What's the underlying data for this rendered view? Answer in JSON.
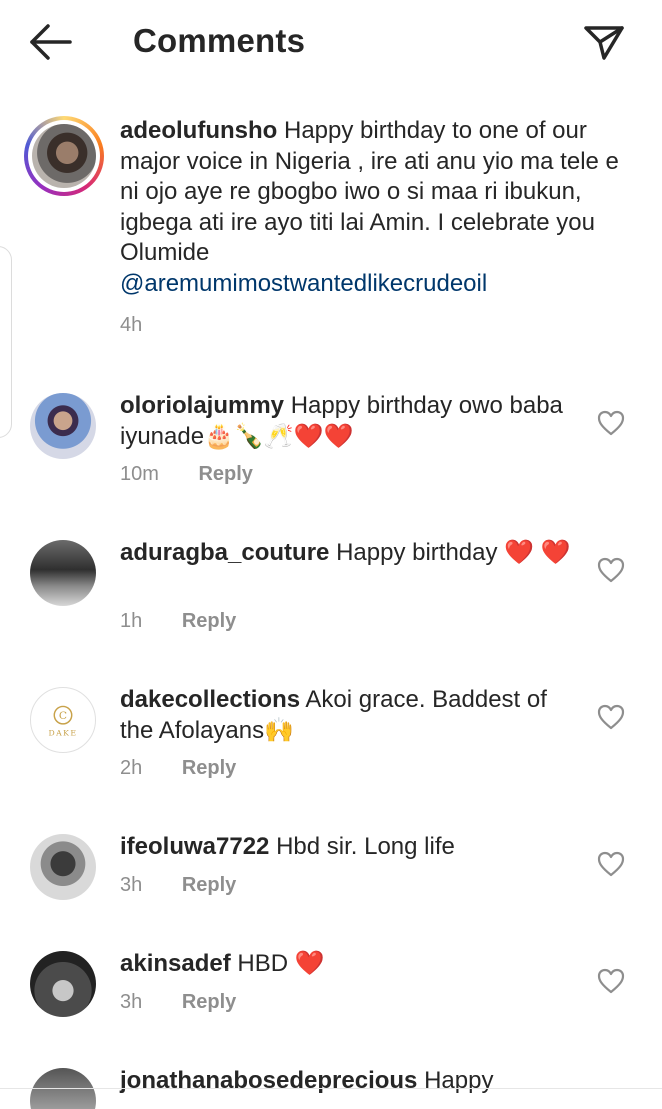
{
  "header": {
    "title": "Comments",
    "back_icon": "arrow-left-icon",
    "share_icon": "paper-plane-icon"
  },
  "caption": {
    "username": "adeolufunsho",
    "text": "Happy birthday to one of our major voice in Nigeria , ire ati anu yio ma tele e ni ojo aye re gbogbo iwo o si maa ri ibukun, igbega ati ire ayo titi lai Amin. I celebrate you Olumide",
    "mention": "@aremumimostwantedlikecrudeoil",
    "time": "4h"
  },
  "comments": [
    {
      "username": "oloriolajummy",
      "text": "Happy birthday owo baba iyunade🎂🍾🥂❤️❤️",
      "time": "10m",
      "reply_label": "Reply"
    },
    {
      "username": "aduragba_couture",
      "text": "Happy birthday ❤️ ❤️",
      "time": "1h",
      "reply_label": "Reply"
    },
    {
      "username": "dakecollections",
      "text": "Akoi grace. Baddest of the Afolayans🙌",
      "time": "2h",
      "reply_label": "Reply",
      "avatar_logo_text": "DAKE"
    },
    {
      "username": "ifeoluwa7722",
      "text": "Hbd sir. Long life",
      "time": "3h",
      "reply_label": "Reply"
    },
    {
      "username": "akinsadef",
      "text": "HBD ❤️",
      "time": "3h",
      "reply_label": "Reply"
    },
    {
      "username": "jonathanabosedeprecious",
      "text": "Happy"
    }
  ],
  "colors": {
    "text": "#262626",
    "secondary": "#8e8e8e",
    "mention": "#00376b",
    "heart": "#ed4956"
  }
}
